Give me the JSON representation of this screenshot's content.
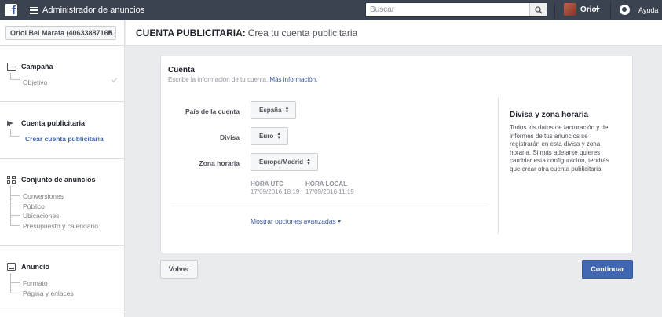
{
  "topbar": {
    "app_title": "Administrador de anuncios",
    "search_placeholder": "Buscar",
    "user_name": "Oriol",
    "help_label": "Ayuda"
  },
  "sidebar": {
    "account_selector": "Oriol Bel Marata (40633887165...",
    "sections": [
      {
        "title": "Campaña",
        "icon": "campaign-icon",
        "items": [
          "Objetivo"
        ]
      },
      {
        "title": "Cuenta publicitaria",
        "icon": "megaphone-icon",
        "items": [
          "Crear cuenta publicitaria"
        ]
      },
      {
        "title": "Conjunto de anuncios",
        "icon": "grid-icon",
        "items": [
          "Conversiones",
          "Público",
          "Ubicaciones",
          "Presupuesto y calendario"
        ]
      },
      {
        "title": "Anuncio",
        "icon": "ad-icon",
        "items": [
          "Formato",
          "Página y enlaces"
        ]
      }
    ]
  },
  "header": {
    "title_bold": "CUENTA PUBLICITARIA:",
    "title_rest": "Crea tu cuenta publicitaria"
  },
  "card": {
    "title": "Cuenta",
    "subtitle": "Escribe la información de tu cuenta.",
    "more_info_link": "Más información.",
    "fields": {
      "country_label": "País de la cuenta",
      "country_value": "España",
      "currency_label": "Divisa",
      "currency_value": "Euro",
      "timezone_label": "Zona horaria",
      "timezone_value": "Europe/Madrid"
    },
    "utc_label": "HORA UTC",
    "utc_value": "17/09/2016 18:19",
    "local_label": "HORA LOCAL",
    "local_value": "17/09/2016 11:19",
    "advanced_link": "Mostrar opciones avanzadas",
    "info_title": "Divisa y zona horaria",
    "info_body": "Todos los datos de facturación y de informes de tus anuncios se registrarán en esta divisa y zona horaria. Si más adelante quieres cambiar esta configuración, tendrás que crear otra cuenta publicitaria."
  },
  "footer": {
    "back_label": "Volver",
    "continue_label": "Continuar"
  },
  "colors": {
    "topbar": "#3b4250",
    "primary": "#4267b2",
    "link": "#365899",
    "background": "#e9ebee"
  }
}
